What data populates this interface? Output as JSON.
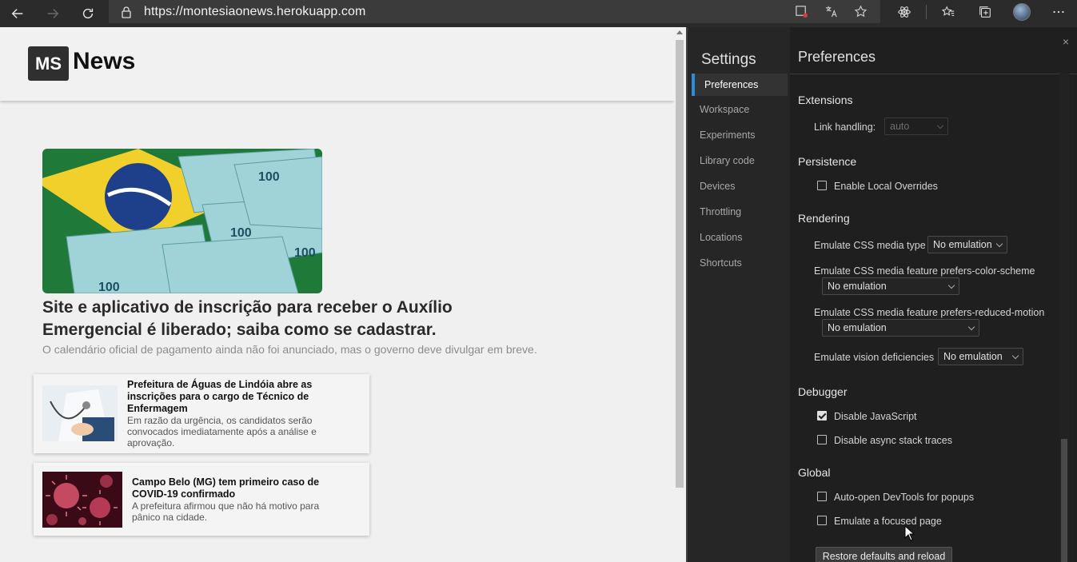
{
  "browser": {
    "url": "https://montesiaonews.herokuapp.com",
    "nav": {
      "back": "arrow-left-icon",
      "forward": "arrow-right-icon",
      "refresh": "refresh-icon"
    },
    "address_icons": [
      "tracking-block-icon",
      "translate-icon",
      "favorite-star-icon"
    ],
    "toolbar_icons": [
      "react-devtools-icon",
      "favorites-icon",
      "collections-icon",
      "profile-avatar",
      "more-menu-icon"
    ]
  },
  "site": {
    "logo_mark": "MS",
    "logo_text": "News",
    "hero": {
      "title": "Site e aplicativo de inscrição para receber o Auxílio Emergencial é liberado; saiba como se cadastrar.",
      "subtitle": "O calendário oficial de pagamento ainda não foi anunciado, mas o governo deve divulgar em breve."
    },
    "cards": [
      {
        "title": "Prefeitura de Águas de Lindóia abre as inscrições para o cargo de Técnico de Enfermagem",
        "desc": "Em razão da urgência, os candidatos serão convocados imediatamente após a análise e aprovação."
      },
      {
        "title": "Campo Belo (MG) tem primeiro caso de COVID-19 confirmado",
        "desc": "A prefeitura afirmou que não há motivo para pânico na cidade."
      }
    ]
  },
  "devtools": {
    "settings_title": "Settings",
    "nav_items": [
      "Preferences",
      "Workspace",
      "Experiments",
      "Library code",
      "Devices",
      "Throttling",
      "Locations",
      "Shortcuts"
    ],
    "active_nav": "Preferences",
    "panel_title": "Preferences",
    "close_glyph": "×",
    "sections": {
      "extensions": {
        "title": "Extensions",
        "link_handling_label": "Link handling:",
        "link_handling_value": "auto"
      },
      "persistence": {
        "title": "Persistence",
        "local_overrides": "Enable Local Overrides"
      },
      "rendering": {
        "title": "Rendering",
        "media_type_label": "Emulate CSS media type",
        "media_type_value": "No emulation",
        "color_scheme_label": "Emulate CSS media feature prefers-color-scheme",
        "color_scheme_value": "No emulation",
        "reduced_motion_label": "Emulate CSS media feature prefers-reduced-motion",
        "reduced_motion_value": "No emulation",
        "vision_label": "Emulate vision deficiencies",
        "vision_value": "No emulation"
      },
      "debugger": {
        "title": "Debugger",
        "disable_js": "Disable JavaScript",
        "disable_async": "Disable async stack traces"
      },
      "global": {
        "title": "Global",
        "auto_open": "Auto-open DevTools for popups",
        "focused_page": "Emulate a focused page"
      }
    },
    "restore_button": "Restore defaults and reload"
  },
  "colors": {
    "accent": "#2f8bd6",
    "devtools_bg": "#1f1f1f",
    "chrome_bg": "#2b2b2b"
  }
}
